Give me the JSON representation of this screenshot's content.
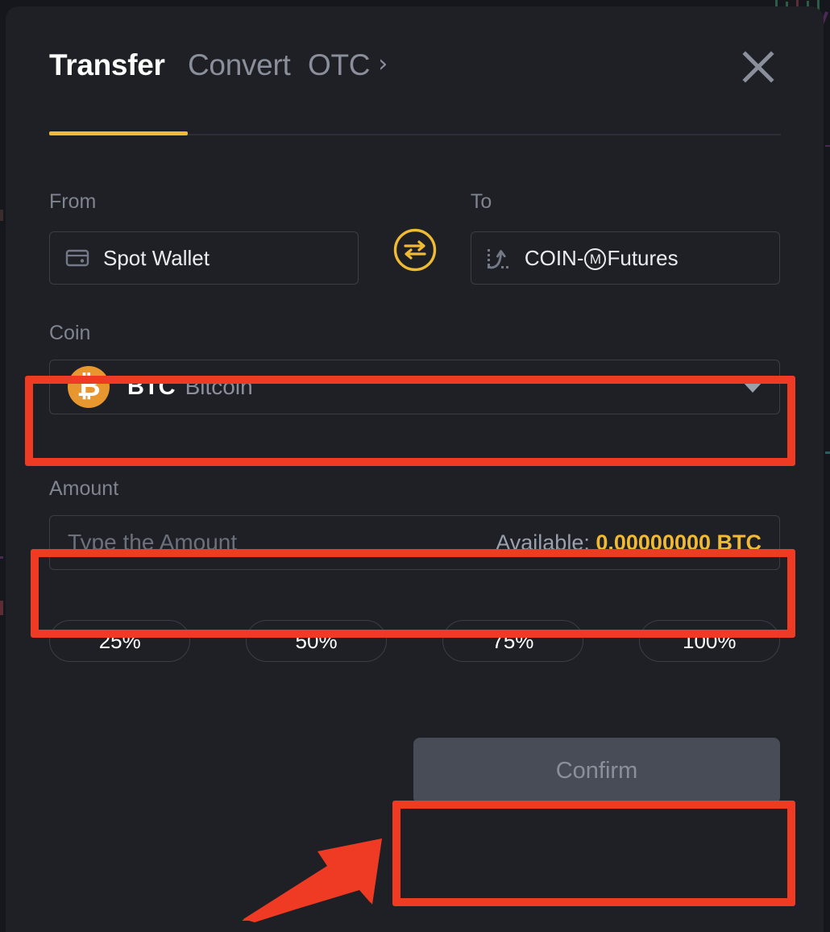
{
  "modal": {
    "tabs": [
      {
        "label": "Transfer",
        "state": "active"
      },
      {
        "label": "Convert",
        "state": "inactive"
      },
      {
        "label": "OTC",
        "state": "inactive",
        "chevron": "›"
      }
    ],
    "close_icon": "close-icon",
    "accent_color": "#f0bb33",
    "background_color": "#1e2026"
  },
  "transfer": {
    "from": {
      "label": "From",
      "value": "Spot Wallet",
      "icon": "wallet-icon"
    },
    "to": {
      "label": "To",
      "value_prefix": "COIN-",
      "value_badge": "M",
      "value_suffix": " Futures",
      "icon": "futures-chart-icon"
    },
    "swap": {
      "icon": "swap-arrows-icon",
      "color": "#f0bb33"
    },
    "coin": {
      "label": "Coin",
      "symbol": "BTC",
      "name": "Bitcoin",
      "logo_glyph": "₿",
      "logo_color": "#e8972f",
      "caret_icon": "chevron-down-icon"
    },
    "amount": {
      "label": "Amount",
      "value": "",
      "placeholder": "Type the Amount",
      "available_label": "Available:",
      "available_value": "0.00000000 BTC",
      "available_value_color": "#f0bb33"
    },
    "percent_buttons": [
      "25%",
      "50%",
      "75%",
      "100%"
    ],
    "confirm": {
      "label": "Confirm",
      "disabled": true,
      "fill_color": "#474c57",
      "text_color": "#8a8f9b"
    }
  },
  "annotations": {
    "color": "#ef3b24",
    "boxes": [
      "coin-selector",
      "amount-input",
      "confirm-button"
    ],
    "arrow": "points-to-confirm-button"
  }
}
